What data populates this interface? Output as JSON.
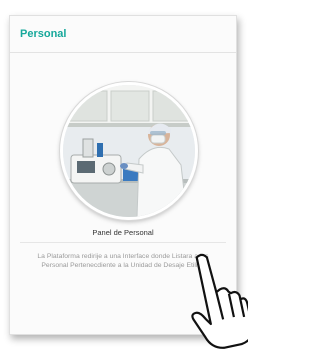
{
  "card": {
    "title": "Personal",
    "avatar_alt": "Laboratory technician",
    "caption": "Panel de Personal",
    "description": "La Plataforma redirije a una Interface donde Listara a les Personal Pertenecdiente a la Unidad de Desaje Etilico"
  },
  "colors": {
    "accent": "#17a89b",
    "card_background": "#fbfbfb"
  },
  "icons": {
    "pointer": "hand-pointer-icon"
  }
}
